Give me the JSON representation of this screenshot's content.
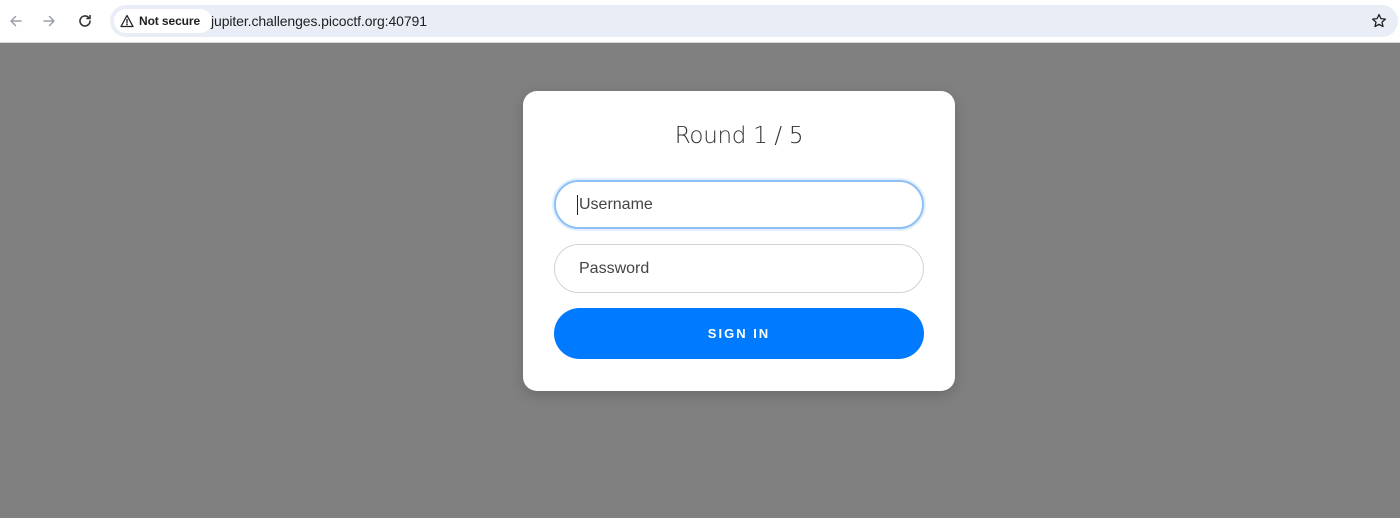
{
  "browser": {
    "security_label": "Not secure",
    "url": "jupiter.challenges.picoctf.org:40791",
    "icons": {
      "back": "arrow-left",
      "forward": "arrow-right",
      "reload": "reload",
      "security": "warning-triangle",
      "bookmark": "star"
    }
  },
  "login": {
    "title": "Round 1 / 5",
    "username_placeholder": "Username",
    "password_placeholder": "Password",
    "submit_label": "SIGN IN"
  },
  "colors": {
    "page_background": "#808080",
    "primary_button": "#007bff",
    "focus_ring": "#8ec0f4"
  }
}
